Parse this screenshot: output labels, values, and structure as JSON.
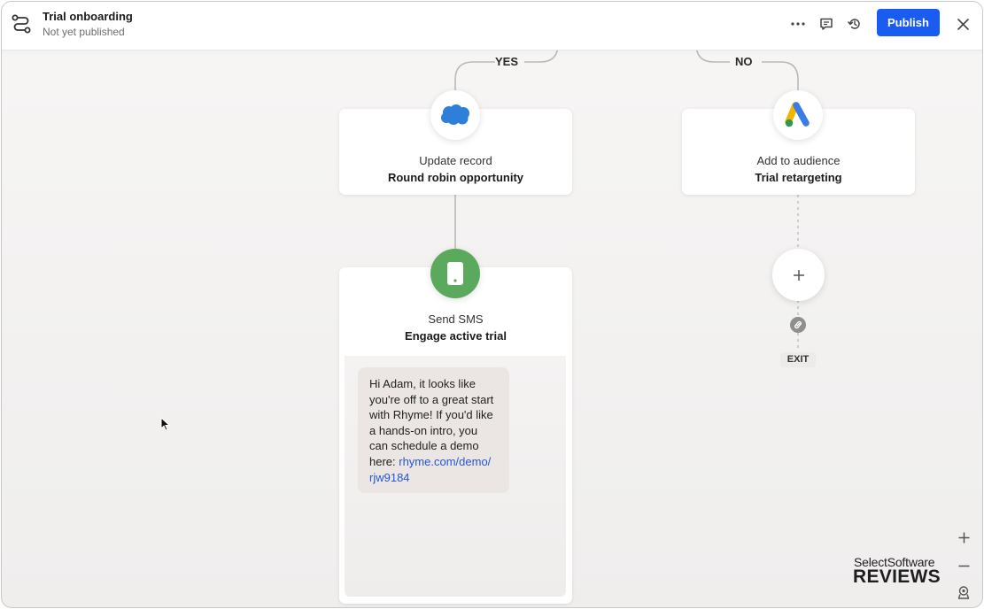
{
  "header": {
    "title": "Trial onboarding",
    "subtitle": "Not yet published",
    "publish_label": "Publish"
  },
  "icons": {
    "flow": "workflow-icon",
    "more": "more-dots-icon",
    "comment": "comment-icon",
    "history": "history-icon",
    "close": "close-icon"
  },
  "branches": {
    "yes": "YES",
    "no": "NO"
  },
  "nodes": {
    "update_record": {
      "line1": "Update record",
      "line2": "Round robin opportunity",
      "icon": "salesforce-cloud-icon",
      "color": "#2d7fd8"
    },
    "add_audience": {
      "line1": "Add to audience",
      "line2": "Trial retargeting",
      "icon": "google-ads-icon"
    },
    "send_sms": {
      "line1": "Send SMS",
      "line2": "Engage active trial",
      "icon": "phone-icon",
      "color": "#5ba95c",
      "message_lines": [
        "Hi Adam, it looks like",
        "you're off to a great start",
        "with Rhyme! If you'd like",
        "a hands-on intro, you",
        "can schedule a demo"
      ],
      "message_prefix": "here: ",
      "link_line1": "rhyme.com/demo/",
      "link_line2": "rjw9184"
    }
  },
  "exit_label": "EXIT",
  "brand": {
    "line1": "SelectSoftware",
    "line2": "REVIEWS"
  },
  "colors": {
    "accent": "#1a5cf0",
    "link": "#2157d8"
  }
}
